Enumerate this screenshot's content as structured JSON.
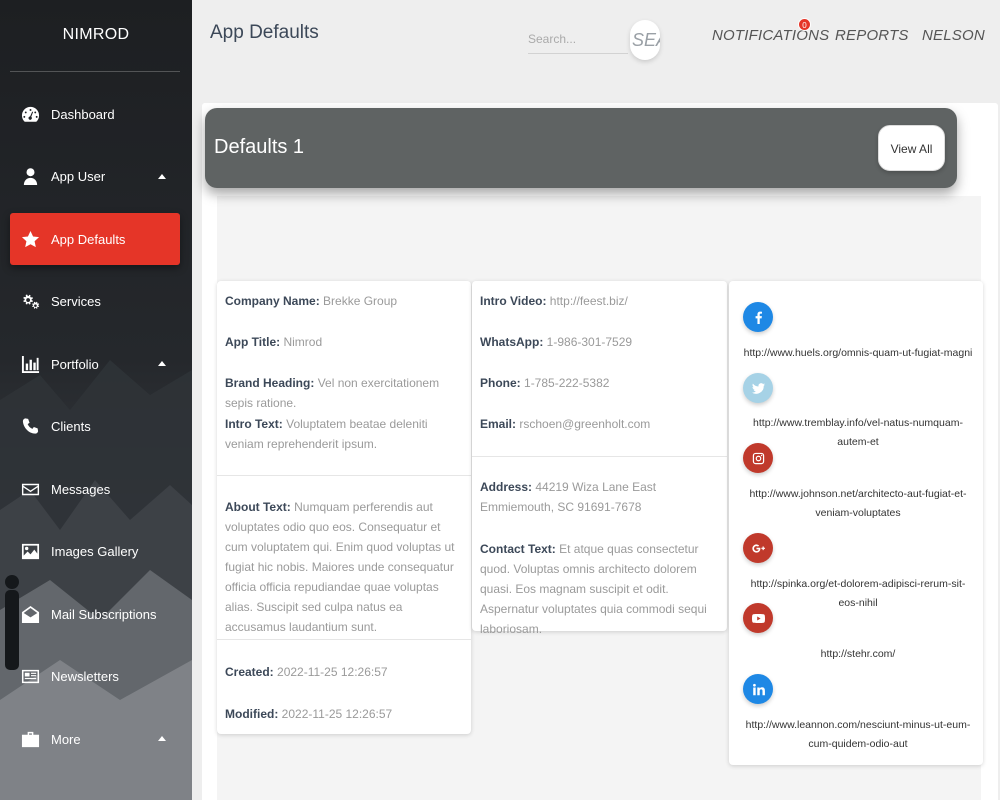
{
  "app": {
    "brand": "NIMROD"
  },
  "sidebar": {
    "items": [
      {
        "label": "Dashboard",
        "icon": "dashboard-icon",
        "active": false,
        "has_caret": false
      },
      {
        "label": "App User",
        "icon": "user-icon",
        "active": false,
        "has_caret": true
      },
      {
        "label": "App Defaults",
        "icon": "star-icon",
        "active": true,
        "has_caret": false
      },
      {
        "label": "Services",
        "icon": "cogs-icon",
        "active": false,
        "has_caret": false
      },
      {
        "label": "Portfolio",
        "icon": "bar-chart-icon",
        "active": false,
        "has_caret": true
      },
      {
        "label": "Clients",
        "icon": "phone-icon",
        "active": false,
        "has_caret": false
      },
      {
        "label": "Messages",
        "icon": "envelope-icon",
        "active": false,
        "has_caret": false
      },
      {
        "label": "Images Gallery",
        "icon": "image-icon",
        "active": false,
        "has_caret": false
      },
      {
        "label": "Mail Subscriptions",
        "icon": "envelope-open-icon",
        "active": false,
        "has_caret": false
      },
      {
        "label": "Newsletters",
        "icon": "newspaper-icon",
        "active": false,
        "has_caret": false
      },
      {
        "label": "More",
        "icon": "briefcase-icon",
        "active": false,
        "has_caret": true
      }
    ]
  },
  "header": {
    "title": "App Defaults",
    "search_placeholder": "Search...",
    "search_button": "SEA",
    "notifications": "NOTIFICATIONS",
    "notifications_count": "0",
    "reports": "REPORTS",
    "user": "NELSON"
  },
  "card": {
    "title": "Defaults 1",
    "view_all": "View All"
  },
  "details": {
    "company_name": {
      "label": "Company Name:",
      "value": "Brekke Group"
    },
    "app_title": {
      "label": "App Title:",
      "value": "Nimrod"
    },
    "brand_heading": {
      "label": "Brand Heading:",
      "value": "Vel non exercitationem sepis ratione."
    },
    "intro_text": {
      "label": "Intro Text:",
      "value": "Voluptatem beatae deleniti veniam reprehenderit ipsum."
    },
    "about_text": {
      "label": "About Text:",
      "value": "Numquam perferendis aut voluptates odio quo eos. Consequatur et cum voluptatem qui. Enim quod voluptas ut fugiat hic nobis. Maiores unde consequatur officia officia repudiandae quae voluptas alias. Suscipit sed culpa natus ea accusamus laudantium sunt."
    },
    "created": {
      "label": "Created:",
      "value": "2022-11-25 12:26:57"
    },
    "modified": {
      "label": "Modified:",
      "value": "2022-11-25 12:26:57"
    },
    "intro_video": {
      "label": "Intro Video:",
      "value": "http://feest.biz/"
    },
    "whatsapp": {
      "label": "WhatsApp:",
      "value": "1-986-301-7529"
    },
    "phone": {
      "label": "Phone:",
      "value": "1-785-222-5382"
    },
    "email": {
      "label": "Email:",
      "value": "rschoen@greenholt.com"
    },
    "address": {
      "label": "Address:",
      "value": "44219 Wiza Lane East Emmiemouth, SC 91691-7678"
    },
    "contact_text": {
      "label": "Contact Text:",
      "value": "Et atque quas consectetur quod. Voluptas omnis architecto dolorem quasi. Eos magnam suscipit et odit. Aspernatur voluptates quia commodi sequi laboriosam."
    }
  },
  "social": [
    {
      "icon": "facebook-icon",
      "color": "#1e88e5",
      "url": "http://www.huels.org/omnis-quam-ut-fugiat-magni"
    },
    {
      "icon": "twitter-icon",
      "color": "#a6d2e6",
      "url": "http://www.tremblay.info/vel-natus-numquam-autem-et"
    },
    {
      "icon": "instagram-icon",
      "color": "#c0392b",
      "url": "http://www.johnson.net/architecto-aut-fugiat-et-veniam-voluptates"
    },
    {
      "icon": "google-plus-icon",
      "color": "#c0392b",
      "url": "http://spinka.org/et-dolorem-adipisci-rerum-sit-eos-nihil"
    },
    {
      "icon": "youtube-icon",
      "color": "#c0392b",
      "url": "http://stehr.com/"
    },
    {
      "icon": "linkedin-icon",
      "color": "#1e88e5",
      "url": "http://www.leannon.com/nesciunt-minus-ut-eum-cum-quidem-odio-aut"
    }
  ]
}
